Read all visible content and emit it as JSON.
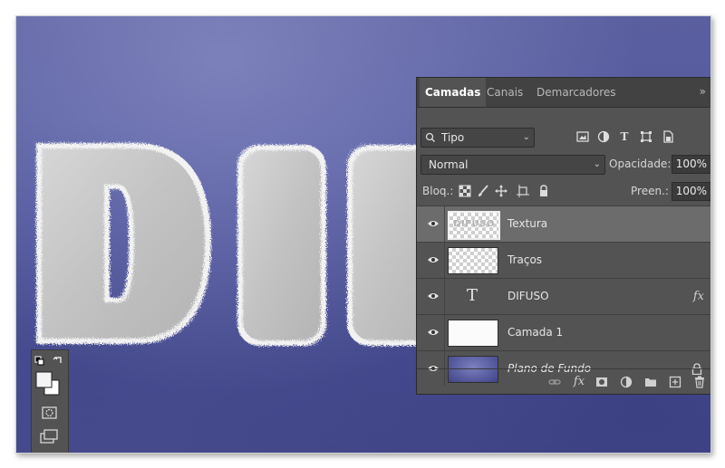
{
  "canvas_text": "DIFUSO",
  "panel": {
    "tabs": [
      "Camadas",
      "Canais",
      "Demarcadores"
    ],
    "collapse_icon": "double-chevron-right",
    "filter": {
      "label": "Tipo",
      "icon": "search"
    },
    "filter_icons": [
      "image-filter",
      "adjustment-filter",
      "type-filter",
      "shape-filter",
      "smart-object-filter"
    ],
    "blend_mode": "Normal",
    "opacity_label": "Opacidade:",
    "opacity_value": "100%",
    "lock_label": "Bloq.:",
    "lock_icons": [
      "lock-transparency",
      "lock-pixels",
      "lock-position",
      "lock-artboard",
      "lock-all"
    ],
    "fill_label": "Preen.:",
    "fill_value": "100%",
    "layers": [
      {
        "name": "Textura",
        "selected": true,
        "type": "pixel-texture",
        "thumb_text": "DIFUSO"
      },
      {
        "name": "Traços",
        "selected": false,
        "type": "transparent"
      },
      {
        "name": "DIFUSO",
        "selected": false,
        "type": "text",
        "fx": "fx"
      },
      {
        "name": "Camada 1",
        "selected": false,
        "type": "white"
      },
      {
        "name": "Plano de Fundo",
        "selected": false,
        "type": "background",
        "locked": true
      }
    ],
    "bottom_icons": [
      "link",
      "fx",
      "mask",
      "adjustment",
      "group",
      "new-layer",
      "delete"
    ],
    "bottom_fx": "fx"
  },
  "colors": {
    "canvas": "#5459a0",
    "panel": "#535353",
    "selected_layer": "#6c6c6c"
  }
}
